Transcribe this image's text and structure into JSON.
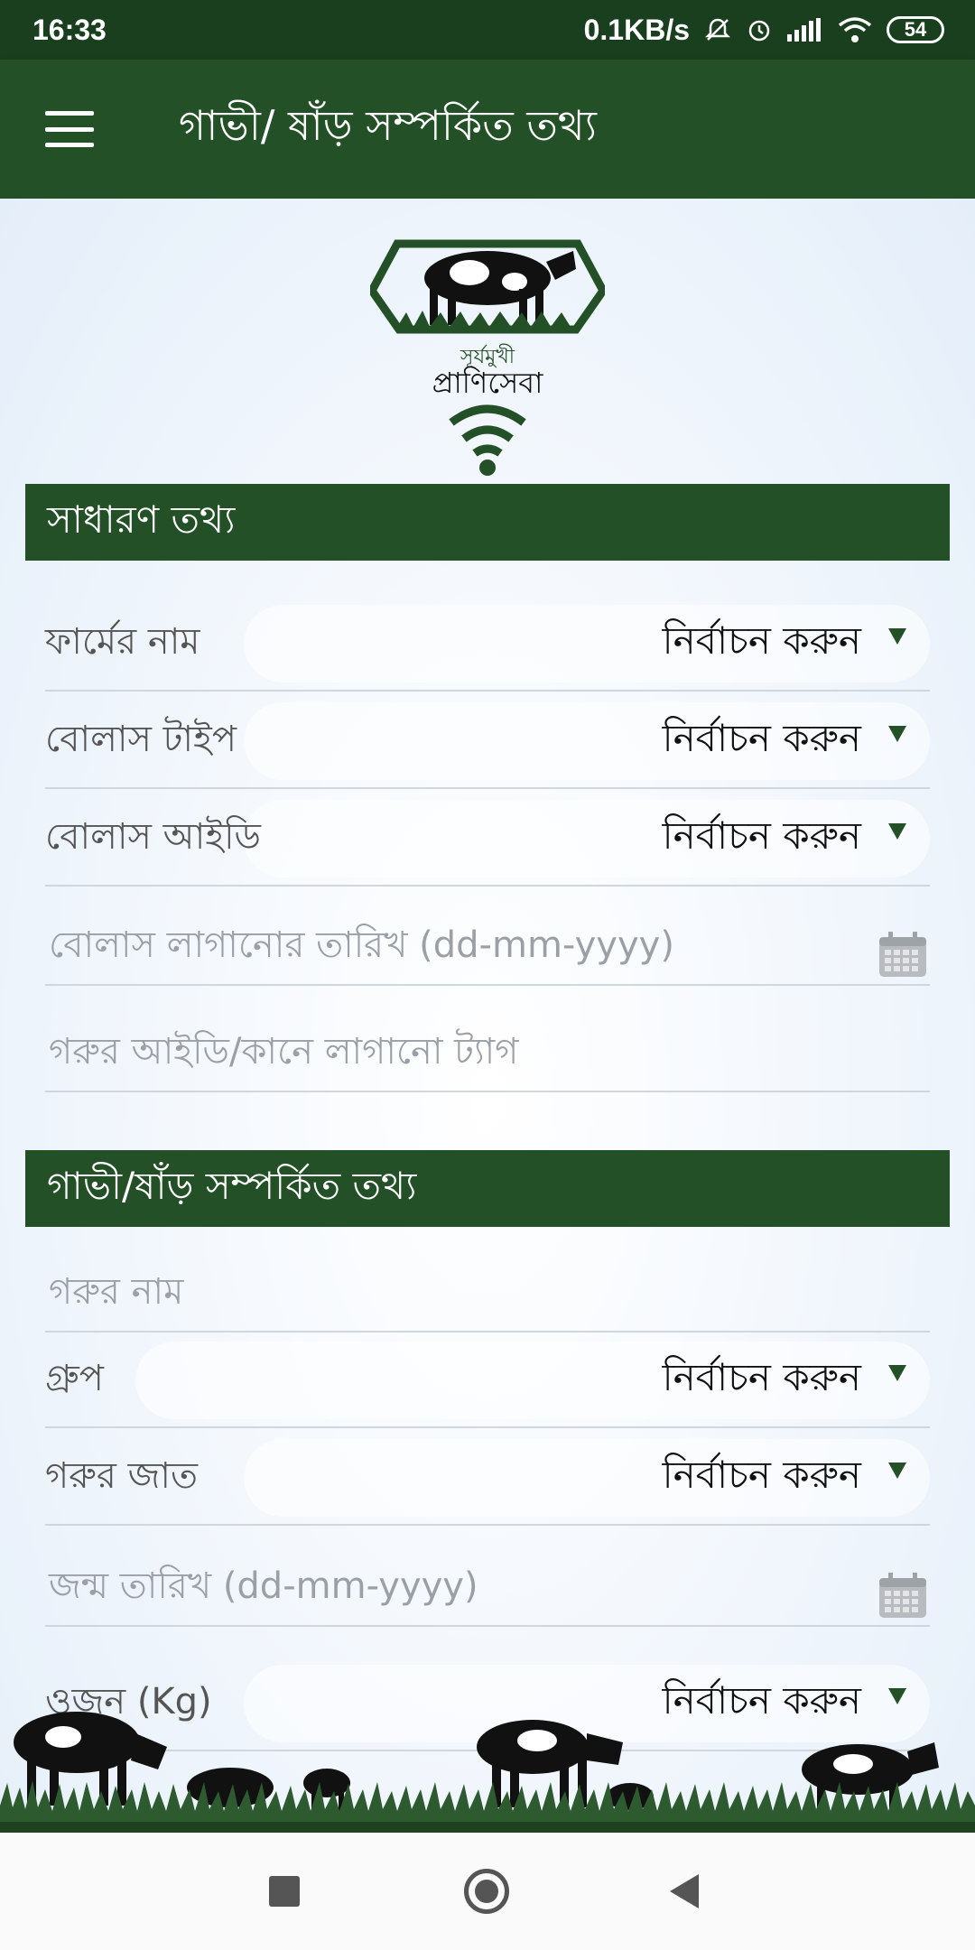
{
  "status_bar": {
    "time": "16:33",
    "net_speed": "0.1KB/s",
    "battery": "54",
    "icons": [
      "mute-icon",
      "alarm-icon",
      "signal-icon",
      "wifi-icon",
      "battery-icon"
    ]
  },
  "app_bar": {
    "title": "গাভী/ ষাঁড় সম্পর্কিত তথ্য",
    "menu_icon": "hamburger-menu-icon"
  },
  "logo": {
    "text_top": "সূর্যমুখী",
    "text_main": "প্রাণিসেবা"
  },
  "general_section": {
    "header": "সাধারণ তথ্য",
    "rows": [
      {
        "label": "ফার্মের নাম",
        "value": "নির্বাচন করুন"
      },
      {
        "label": "বোলাস টাইপ",
        "value": "নির্বাচন করুন"
      },
      {
        "label": "বোলাস আইডি",
        "value": "নির্বাচন করুন"
      }
    ],
    "bolus_date_placeholder": "বোলাস লাগানোর তারিখ (dd-mm-yyyy)",
    "ear_tag_placeholder": "গরুর আইডি/কানে লাগানো ট্যাগ"
  },
  "cow_section": {
    "header": "গাভী/ষাঁড় সম্পর্কিত তথ্য",
    "name_placeholder": "গরুর নাম",
    "rows": [
      {
        "label": "গ্রুপ",
        "value": "নির্বাচন করুন"
      },
      {
        "label": "গরুর জাত",
        "value": "নির্বাচন করুন"
      }
    ],
    "birth_date_placeholder": "জন্ম তারিখ (dd-mm-yyyy)",
    "weight_row": {
      "label": "ওজন (Kg)",
      "value": "নির্বাচন করুন"
    }
  },
  "colors": {
    "primary": "#245028",
    "status_bar": "#1a3f1e",
    "placeholder": "#9aa0a6"
  }
}
